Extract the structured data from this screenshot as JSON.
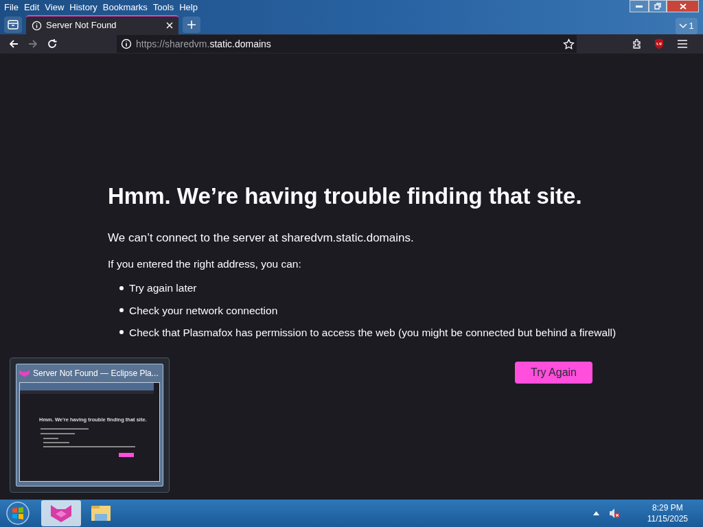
{
  "menu": [
    "File",
    "Edit",
    "View",
    "History",
    "Bookmarks",
    "Tools",
    "Help"
  ],
  "tabs": [
    {
      "title": "Server Not Found",
      "selected": true
    }
  ],
  "tab_count": "1",
  "address": {
    "prefix": "https://sharedvm.",
    "host": "static.domains"
  },
  "error": {
    "heading": "Hmm. We’re having trouble finding that site.",
    "message": "We can’t connect to the server at sharedvm.static.domains.",
    "hint": "If you entered the right address, you can:",
    "suggestions": [
      "Try again later",
      "Check your network connection",
      "Check that Plasmafox has permission to access the web (you might be connected but behind a firewall)"
    ],
    "button": "Try Again"
  },
  "preview": {
    "title": "Server Not Found — Eclipse Pla...",
    "heading": "Hmm. We're having trouble finding that site."
  },
  "taskbar": {
    "time": "8:29 PM",
    "date": "11/15/2025"
  }
}
